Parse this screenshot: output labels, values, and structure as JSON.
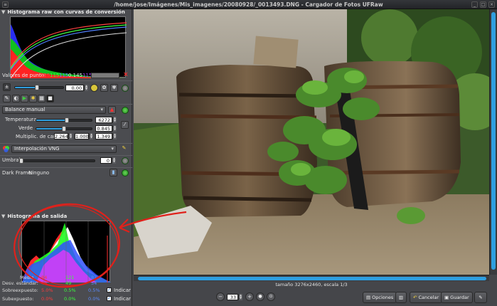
{
  "window": {
    "title": "/home/jose/Imágenes/Mis_imagenes/20080928/_0013493.DNG - Cargador de Fotos UFRaw",
    "minimize": "_",
    "maximize": "□",
    "close": "×"
  },
  "raw_histogram": {
    "header": "Histograma raw con curvas de conversión",
    "triangle": "▼"
  },
  "point_values": {
    "label": "Valores de punto:",
    "r": "115",
    "g": "115",
    "b": "115",
    "lum": "0.145",
    "extra": "115",
    "colors": {
      "r": "#ff3b3b",
      "g": "#3bff3b",
      "b": "#5b8bff",
      "extra": "#b040ff"
    }
  },
  "exposure": {
    "value": "0.00",
    "level": 0.45
  },
  "white_balance": {
    "mode": "Balance manual",
    "temperature_label": "Temperatura",
    "temperature": "6272",
    "temperature_level": 0.55,
    "green_label": "Verde",
    "green": "0.845",
    "green_level": 0.5,
    "multipliers_label": "Multiplic. de canal",
    "mult_r": "2.264",
    "mult_g": "1.000",
    "mult_b": "1.349"
  },
  "interpolation": {
    "mode": "Interpolación VNG"
  },
  "threshold": {
    "label": "Umbral",
    "value": "0"
  },
  "dark_frame": {
    "label": "Dark Frame:",
    "value": "Ninguno"
  },
  "output_histogram": {
    "header": "Histograma de salida",
    "triangle": "▼"
  },
  "stats": {
    "mean_label": "Media",
    "mean_r": "84",
    "mean_g": "121",
    "mean_b": "87",
    "std_label": "Desv. estándar:",
    "std_r": "46",
    "std_g": "49",
    "std_b": "54",
    "over_label": "Sobreexpuesto:",
    "over_r": "5.0%",
    "over_g": "0.5%",
    "over_b": "0.5%",
    "under_label": "Subexpuesto:",
    "under_r": "0.0%",
    "under_g": "0.0%",
    "under_b": "0.0%",
    "indicate": "Indicar",
    "check_mark": "✓"
  },
  "image_info": {
    "size_text": "tamaño 3276x2460, escala 1/3"
  },
  "zoom": {
    "value": "33",
    "minus": "−",
    "plus": "+"
  },
  "buttons": {
    "options": "Opciones",
    "cancel": "Cancelar",
    "save": "Guardar"
  },
  "colors": {
    "accent": "#2f9fe0",
    "panel": "#4b4c50",
    "annotation_red": "#e0211b"
  }
}
